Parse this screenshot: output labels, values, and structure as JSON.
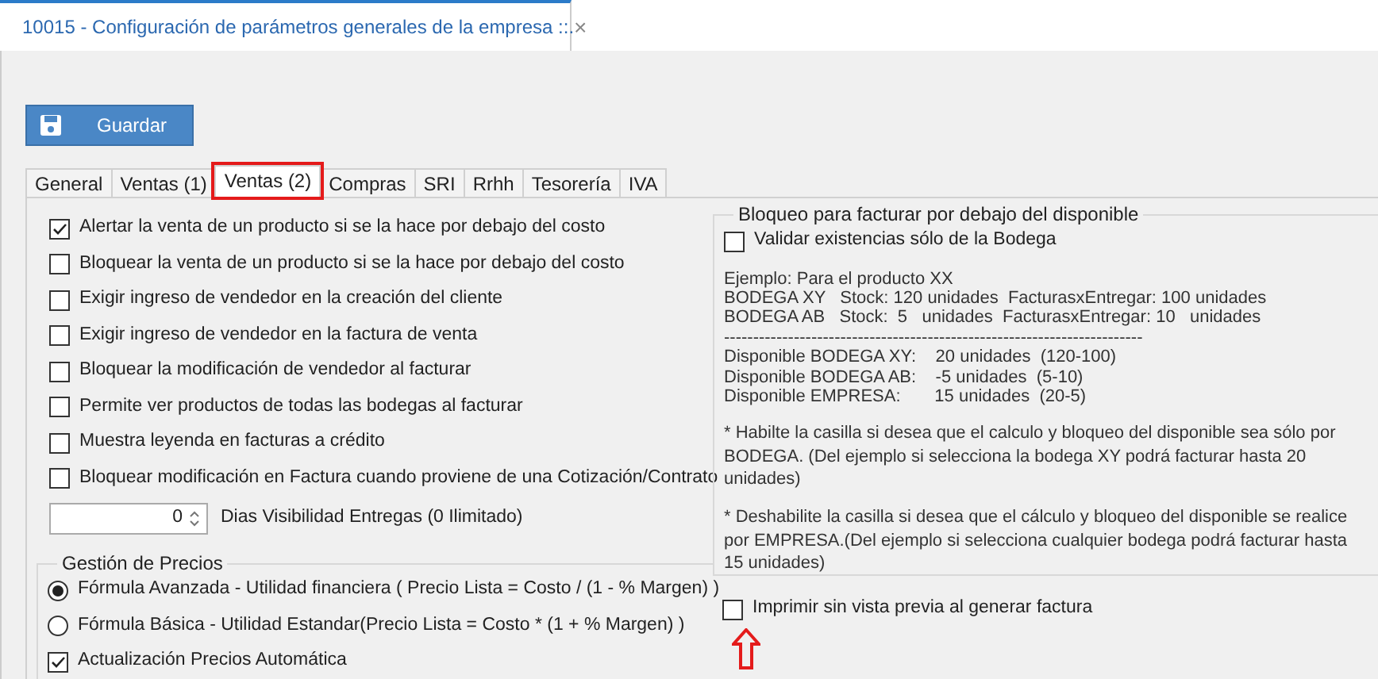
{
  "document_tab": {
    "title": "10015 - Configuración de parámetros generales de la empresa ::.",
    "close": "×"
  },
  "toolbar": {
    "save_button": "Guardar"
  },
  "tabs": [
    {
      "label": "General",
      "selected": false,
      "highlighted": false
    },
    {
      "label": "Ventas (1)",
      "selected": false,
      "highlighted": false
    },
    {
      "label": "Ventas (2)",
      "selected": true,
      "highlighted": true
    },
    {
      "label": "Compras",
      "selected": false,
      "highlighted": false
    },
    {
      "label": "SRI",
      "selected": false,
      "highlighted": false
    },
    {
      "label": "Rrhh",
      "selected": false,
      "highlighted": false
    },
    {
      "label": "Tesorería",
      "selected": false,
      "highlighted": false
    },
    {
      "label": "IVA",
      "selected": false,
      "highlighted": false
    }
  ],
  "options": [
    {
      "label": "Alertar la venta de un producto si se la hace por debajo del costo",
      "checked": true
    },
    {
      "label": "Bloquear la venta de un producto si se la hace por debajo del costo",
      "checked": false
    },
    {
      "label": "Exigir ingreso de vendedor en la creación del cliente",
      "checked": false
    },
    {
      "label": "Exigir ingreso de vendedor en la factura de venta",
      "checked": false
    },
    {
      "label": "Bloquear la modificación de vendedor al facturar",
      "checked": false
    },
    {
      "label": "Permite ver productos de todas las bodegas al facturar",
      "checked": false
    },
    {
      "label": "Muestra leyenda en facturas a crédito",
      "checked": false
    },
    {
      "label": "Bloquear modificación en Factura cuando proviene de una Cotización/Contrato",
      "checked": false
    }
  ],
  "visibility_days": {
    "value": "0",
    "label": "Dias Visibilidad Entregas (0 Ilimitado)"
  },
  "pricing": {
    "title": "Gestión de Precios",
    "formulas": [
      {
        "label": "Fórmula Avanzada - Utilidad financiera ( Precio Lista = Costo / (1 - % Margen) )",
        "selected": true
      },
      {
        "label": "Fórmula Básica - Utilidad Estandar(Precio Lista = Costo * (1 + % Margen) )",
        "selected": false
      }
    ],
    "auto_update": {
      "label": "Actualización Precios Automática",
      "checked": true
    }
  },
  "stock_lock": {
    "title": "Bloqueo para facturar por debajo del disponible",
    "option": {
      "label": "Validar existencias sólo de la Bodega",
      "checked": false
    },
    "example_lines": [
      "Ejemplo: Para el producto XX",
      "BODEGA XY   Stock: 120 unidades  FacturasxEntregar: 100 unidades",
      "BODEGA AB   Stock:  5   unidades  FacturasxEntregar: 10   unidades",
      "------------------------------------------------------------------------",
      "Disponible BODEGA XY:    20 unidades  (120-100)",
      "Disponible BODEGA AB:    -5 unidades  (5-10)",
      "Disponible EMPRESA:       15 unidades  (20-5)"
    ],
    "notes": [
      "* Habilte la casilla si desea que el calculo y bloqueo del disponible sea sólo por BODEGA. (Del ejemplo si selecciona la bodega XY podrá facturar hasta 20 unidades)",
      "* Deshabilite la casilla si desea que el cálculo y bloqueo del disponible se realice por EMPRESA.(Del ejemplo si selecciona cualquier bodega podrá facturar hasta 15 unidades)"
    ]
  },
  "print_option": {
    "label": "Imprimir sin vista previa al generar factura",
    "checked": false
  }
}
